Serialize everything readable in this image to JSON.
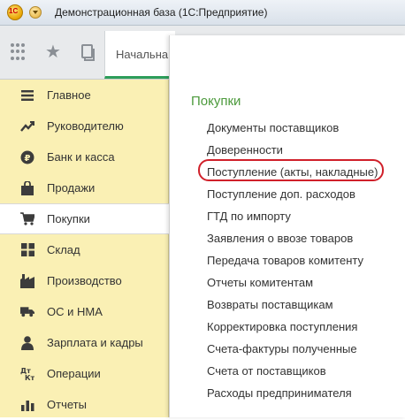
{
  "window": {
    "title": "Демонстрационная база  (1С:Предприятие)"
  },
  "toolbar": {
    "tab_label": "Начальна"
  },
  "sidebar": {
    "items": [
      {
        "label": "Главное",
        "icon": "menu-lines-icon"
      },
      {
        "label": "Руководителю",
        "icon": "trend-chart-icon"
      },
      {
        "label": "Банк и касса",
        "icon": "ruble-coin-icon"
      },
      {
        "label": "Продажи",
        "icon": "shopping-bag-icon"
      },
      {
        "label": "Покупки",
        "icon": "shopping-cart-icon"
      },
      {
        "label": "Склад",
        "icon": "warehouse-grid-icon"
      },
      {
        "label": "Производство",
        "icon": "production-icon"
      },
      {
        "label": "ОС и НМА",
        "icon": "truck-icon"
      },
      {
        "label": "Зарплата и кадры",
        "icon": "person-icon"
      },
      {
        "label": "Операции",
        "icon": "operations-icon"
      },
      {
        "label": "Отчеты",
        "icon": "reports-chart-icon"
      }
    ],
    "active_index": 4
  },
  "panel": {
    "title": "Покупки",
    "items": [
      "Документы поставщиков",
      "Доверенности",
      "Поступление (акты, накладные)",
      "Поступление доп. расходов",
      "ГТД по импорту",
      "Заявления о ввозе товаров",
      "Передача товаров комитенту",
      "Отчеты комитентам",
      "Возвраты поставщикам",
      "Корректировка поступления",
      "Счета-фактуры полученные",
      "Счета от поставщиков",
      "Расходы предпринимателя"
    ],
    "highlighted_index": 2
  },
  "colors": {
    "sidebar_bg": "#faf0b4",
    "panel_title": "#4c9a3c",
    "highlight_border": "#d0202a",
    "tab_underline": "#2e9e5a"
  }
}
